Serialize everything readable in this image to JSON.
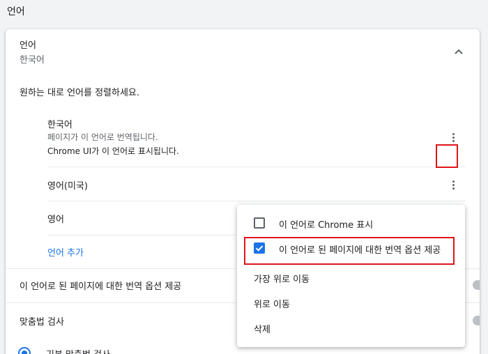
{
  "page": {
    "heading": "언어"
  },
  "language_section": {
    "title": "언어",
    "current": "한국어",
    "instruction": "원하는 대로 언어를 정렬하세요.",
    "languages": [
      {
        "name": "한국어",
        "sub1": "페이지가 이 언어로 번역됩니다.",
        "sub2": "Chrome UI가 이 언어로 표시됩니다."
      },
      {
        "name": "영어(미국)"
      },
      {
        "name": "영어"
      }
    ],
    "add_language": "언어 추가",
    "offer_translate": "이 언어로 된 페이지에 대한 번역 옵션 제공"
  },
  "spellcheck": {
    "title": "맞춤법 검사",
    "basic_option": "기본 맞춤법 검사"
  },
  "context_menu": {
    "items": [
      {
        "label": "이 언어로 Chrome 표시",
        "checked": false
      },
      {
        "label": "이 언어로 된 페이지에 대한 번역 옵션 제공",
        "checked": true
      },
      {
        "label": "가장 위로 이동"
      },
      {
        "label": "위로 이동"
      },
      {
        "label": "삭제"
      }
    ]
  },
  "colors": {
    "accent": "#1a73e8",
    "highlight": "#e0141a"
  }
}
